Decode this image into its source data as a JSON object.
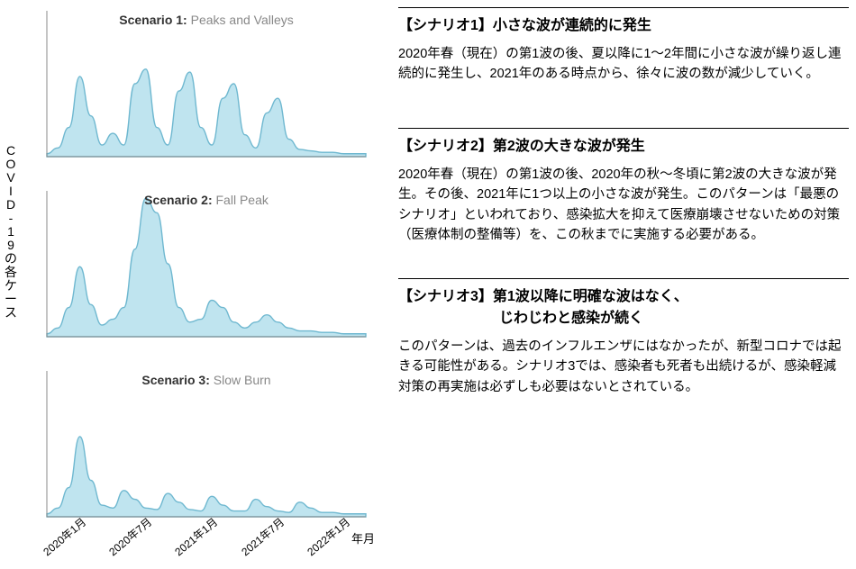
{
  "vertical_axis_label": "COVID-19の各ケース",
  "x_axis_unit": "年月",
  "x_ticks": [
    "2020年1月",
    "2020年7月",
    "2021年1月",
    "2021年7月",
    "2022年1月"
  ],
  "scenarios": [
    {
      "chart_label_strong": "Scenario 1:",
      "chart_label_thin": " Peaks and Valleys",
      "title": "【シナリオ1】小さな波が連続的に発生",
      "body": "2020年春（現在）の第1波の後、夏以降に1〜2年間に小さな波が繰り返し連続的に発生し、2021年のある時点から、徐々に波の数が減少していく。"
    },
    {
      "chart_label_strong": "Scenario 2:",
      "chart_label_thin": " Fall Peak",
      "title": "【シナリオ2】第2波の大きな波が発生",
      "body": "2020年春（現在）の第1波の後、2020年の秋〜冬頃に第2波の大きな波が発生。その後、2021年に1つ以上の小さな波が発生。このパターンは「最悪のシナリオ」といわれており、感染拡大を抑えて医療崩壊させないための対策（医療体制の整備等）を、この秋までに実施する必要がある。"
    },
    {
      "chart_label_strong": "Scenario 3:",
      "chart_label_thin": " Slow Burn",
      "title": "【シナリオ3】第1波以降に明確な波はなく、\n　　　　　　　じわじわと感染が続く",
      "body": "このパターンは、過去のインフルエンザにはなかったが、新型コロナでは起きる可能性がある。シナリオ3では、感染者も死者も出続けるが、感染軽減対策の再実施は必ずしも必要はないとされている。"
    }
  ],
  "chart_style": {
    "fill": "#bfe4ef",
    "stroke": "#6fb8d0",
    "axis": "#888"
  },
  "chart_data": [
    {
      "type": "area",
      "title": "Scenario 1: Peaks and Valleys",
      "xlabel": "年月",
      "ylabel": "COVID-19の各ケース",
      "x_extent": [
        "2020-01",
        "2022-06"
      ],
      "ylim": [
        0,
        100
      ],
      "x": [
        0,
        1,
        2,
        3,
        4,
        5,
        6,
        7,
        8,
        9,
        10,
        11,
        12,
        13,
        14,
        15,
        16,
        17,
        18,
        19,
        20,
        21,
        22,
        23,
        24,
        25,
        26,
        27,
        28,
        29
      ],
      "values": [
        2,
        6,
        20,
        55,
        28,
        8,
        16,
        8,
        50,
        60,
        20,
        8,
        45,
        58,
        20,
        8,
        40,
        50,
        15,
        6,
        30,
        40,
        12,
        5,
        4,
        3,
        3,
        2,
        2,
        2
      ]
    },
    {
      "type": "area",
      "title": "Scenario 2: Fall Peak",
      "xlabel": "年月",
      "ylabel": "COVID-19の各ケース",
      "x_extent": [
        "2020-01",
        "2022-06"
      ],
      "ylim": [
        0,
        100
      ],
      "x": [
        0,
        1,
        2,
        3,
        4,
        5,
        6,
        7,
        8,
        9,
        10,
        11,
        12,
        13,
        14,
        15,
        16,
        17,
        18,
        19,
        20,
        21,
        22,
        23,
        24,
        25,
        26,
        27,
        28,
        29
      ],
      "values": [
        2,
        6,
        20,
        48,
        22,
        8,
        12,
        20,
        60,
        95,
        85,
        50,
        20,
        10,
        12,
        25,
        20,
        10,
        6,
        10,
        15,
        10,
        6,
        4,
        4,
        3,
        3,
        2,
        2,
        2
      ]
    },
    {
      "type": "area",
      "title": "Scenario 3: Slow Burn",
      "xlabel": "年月",
      "ylabel": "COVID-19の各ケース",
      "x_extent": [
        "2020-01",
        "2022-06"
      ],
      "ylim": [
        0,
        100
      ],
      "x": [
        0,
        1,
        2,
        3,
        4,
        5,
        6,
        7,
        8,
        9,
        10,
        11,
        12,
        13,
        14,
        15,
        16,
        17,
        18,
        19,
        20,
        21,
        22,
        23,
        24,
        25,
        26,
        27,
        28,
        29
      ],
      "values": [
        2,
        6,
        20,
        55,
        25,
        8,
        6,
        18,
        12,
        6,
        5,
        16,
        10,
        5,
        4,
        14,
        8,
        4,
        4,
        12,
        7,
        4,
        3,
        10,
        6,
        3,
        3,
        2,
        2,
        2
      ]
    }
  ]
}
